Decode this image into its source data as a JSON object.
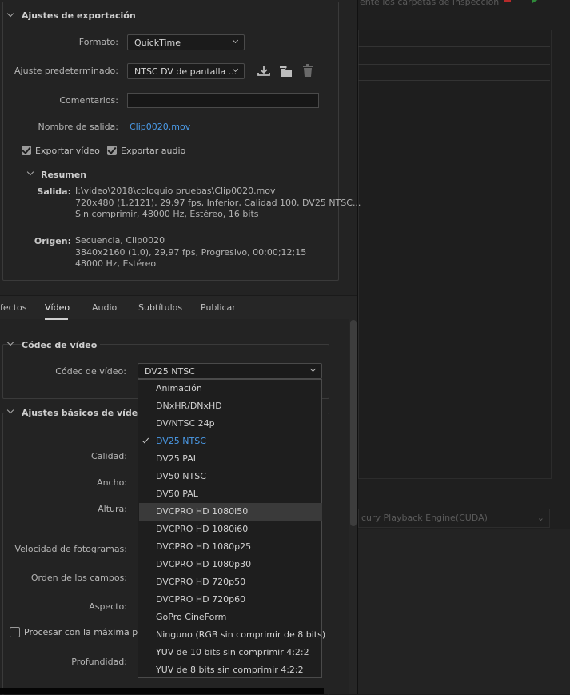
{
  "right": {
    "top_text": "ente los carpetas de inspección",
    "engine": "cury Playback Engine(CUDA)"
  },
  "export": {
    "heading": "Ajustes de exportación",
    "format_label": "Formato:",
    "format_value": "QuickTime",
    "preset_label": "Ajuste predeterminado:",
    "preset_value": "NTSC DV de pantalla ...",
    "comments_label": "Comentarios:",
    "comments_value": "",
    "output_label": "Nombre de salida:",
    "output_value": "Clip0020.mov",
    "export_video_label": "Exportar vídeo",
    "export_audio_label": "Exportar audio",
    "export_video_checked": true,
    "export_audio_checked": true
  },
  "summary": {
    "heading": "Resumen",
    "output_key": "Salida:",
    "output_lines": [
      "I:\\video\\2018\\coloquio pruebas\\Clip0020.mov",
      "720x480 (1,2121), 29,97 fps, Inferior, Calidad 100, DV25 NTSC...",
      "Sin comprimir, 48000 Hz, Estéreo, 16 bits"
    ],
    "source_key": "Origen:",
    "source_lines": [
      "Secuencia, Clip0020",
      "3840x2160 (1,0), 29,97 fps, Progresivo, 00;00;12;15",
      "48000 Hz, Estéreo"
    ]
  },
  "tabs": [
    "fectos",
    "Vídeo",
    "Audio",
    "Subtítulos",
    "Publicar"
  ],
  "active_tab": "Vídeo",
  "codec": {
    "heading": "Códec de vídeo",
    "label": "Códec de vídeo:",
    "value": "DV25 NTSC"
  },
  "basic": {
    "heading": "Ajustes básicos de vídeo",
    "quality_label": "Calidad:",
    "width_label": "Ancho:",
    "height_label": "Altura:",
    "fps_label": "Velocidad de fotogramas:",
    "field_order_label": "Orden de los campos:",
    "aspect_label": "Aspecto:",
    "max_render_label": "Procesar con la máxima prof",
    "depth_label": "Profundidad:"
  },
  "dropdown": {
    "options": [
      "Animación",
      "DNxHR/DNxHD",
      "DV/NTSC 24p",
      "DV25 NTSC",
      "DV25 PAL",
      "DV50 NTSC",
      "DV50 PAL",
      "DVCPRO HD 1080i50",
      "DVCPRO HD 1080i60",
      "DVCPRO HD 1080p25",
      "DVCPRO HD 1080p30",
      "DVCPRO HD 720p50",
      "DVCPRO HD 720p60",
      "GoPro CineForm",
      "Ninguno (RGB sin comprimir de 8 bits)",
      "YUV de 10 bits sin comprimir 4:2:2",
      "YUV de 8 bits sin comprimir 4:2:2"
    ],
    "selected_index": 3,
    "hover_index": 7
  },
  "colors": {
    "accent": "#4b9be8",
    "panel": "#232323",
    "background": "#1d1d1d"
  },
  "icons": [
    "chevron-down-icon",
    "save-preset-icon",
    "import-preset-icon",
    "trash-icon",
    "checkmark-icon"
  ]
}
